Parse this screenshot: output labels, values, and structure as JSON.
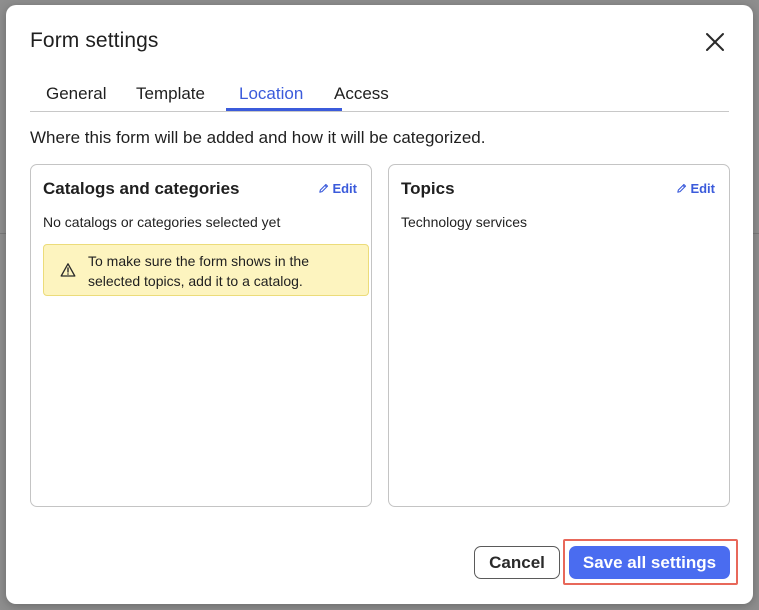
{
  "dialog": {
    "title": "Form settings"
  },
  "tabs": [
    {
      "label": "General",
      "active": false
    },
    {
      "label": "Template",
      "active": false
    },
    {
      "label": "Location",
      "active": true
    },
    {
      "label": "Access",
      "active": false
    }
  ],
  "description": "Where this form will be added and how it will be categorized.",
  "catalogs_card": {
    "title": "Catalogs and categories",
    "edit_label": "Edit",
    "empty_text": "No catalogs or categories selected yet",
    "warning_text": "To make sure the form shows in the selected topics, add it to a catalog."
  },
  "topics_card": {
    "title": "Topics",
    "edit_label": "Edit",
    "value": "Technology services"
  },
  "footer": {
    "cancel_label": "Cancel",
    "save_label": "Save all settings"
  },
  "colors": {
    "accent": "#3b5bdb",
    "primary_button": "#4a6cf0",
    "warning_bg": "#fdf4bf",
    "highlight": "#e8685a"
  },
  "icons": {
    "close": "close-icon",
    "edit": "pencil-icon",
    "warning": "warning-triangle-icon"
  }
}
